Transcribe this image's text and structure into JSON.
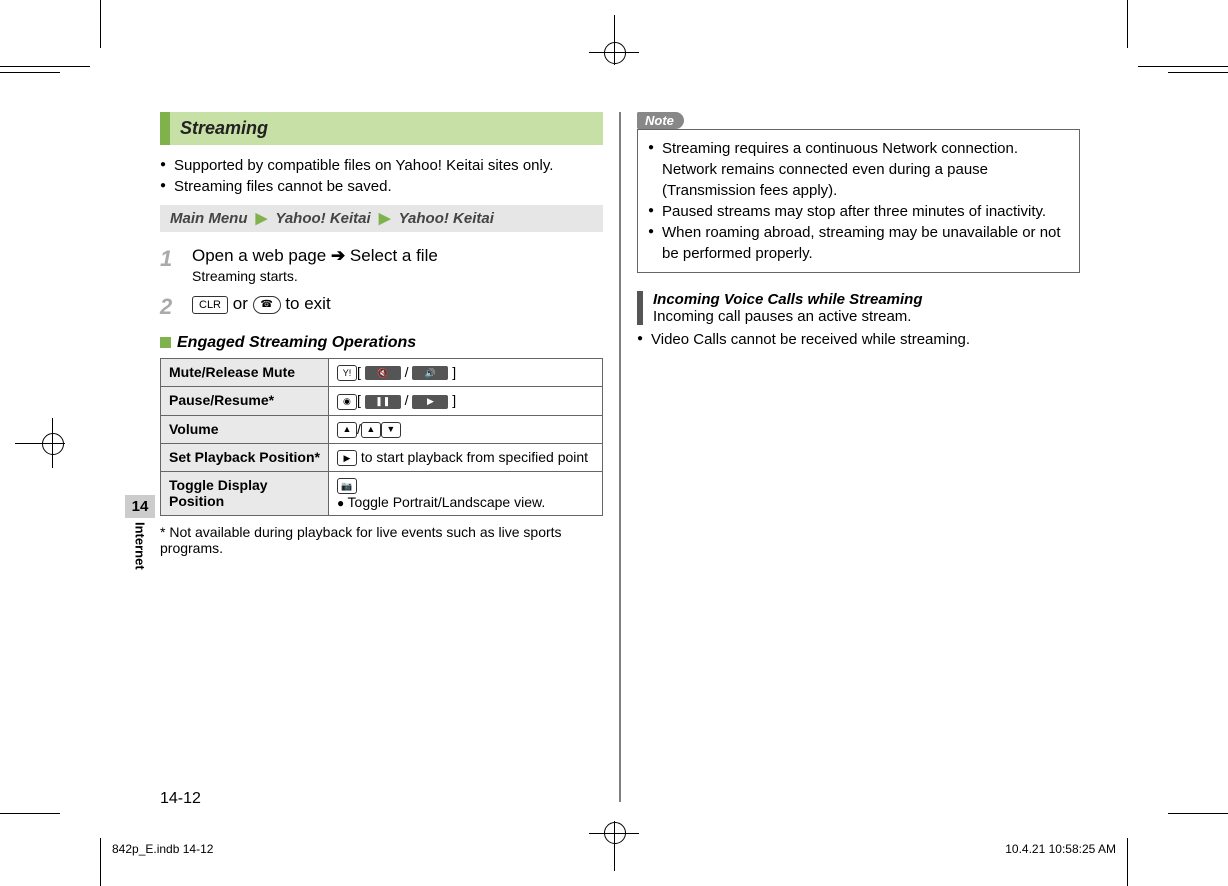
{
  "side_tab": {
    "chapter": "14",
    "label": "Internet"
  },
  "left": {
    "heading": "Streaming",
    "intro": [
      "Supported by compatible files on Yahoo! Keitai sites only.",
      "Streaming files cannot be saved."
    ],
    "nav": [
      "Main Menu",
      "Yahoo! Keitai",
      "Yahoo! Keitai"
    ],
    "steps": [
      {
        "num": "1",
        "line_a": "Open a web page",
        "line_b": "Select a file",
        "sub": "Streaming starts."
      },
      {
        "num": "2",
        "key1": "CLR",
        "mid": " or ",
        "tail": " to exit"
      }
    ],
    "ops_heading": "Engaged Streaming Operations",
    "table": [
      {
        "label": "Mute/Release Mute"
      },
      {
        "label": "Pause/Resume*"
      },
      {
        "label": "Volume"
      },
      {
        "label": "Set Playback Position*",
        "desc": " to start playback from specified point"
      },
      {
        "label": "Toggle Display Position",
        "desc": "Toggle Portrait/Landscape view."
      }
    ],
    "footnote": "* Not available during playback for live events such as live sports programs."
  },
  "right": {
    "note_heading": "Note",
    "notes": [
      "Streaming requires a continuous Network connection. Network remains connected even during a pause (Transmission fees apply).",
      "Paused streams may stop after three minutes of inactivity.",
      "When roaming abroad, streaming may be unavailable or not be performed properly."
    ],
    "incoming": {
      "title": "Incoming Voice Calls while Streaming",
      "sub": "Incoming call pauses an active stream.",
      "bullets": [
        "Video Calls cannot be received while streaming."
      ]
    }
  },
  "footer": {
    "page": "14-12",
    "file": "842p_E.indb   14-12",
    "time": "10.4.21   10:58:25 AM"
  }
}
